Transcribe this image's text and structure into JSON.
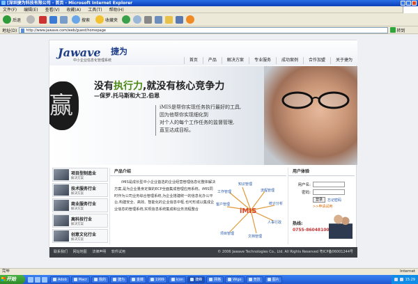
{
  "window": {
    "title": "[深圳捷为科技有限公司 - 首页 - Microsoft Internet Explorer"
  },
  "menu": [
    "文件(F)",
    "编辑(E)",
    "查看(V)",
    "收藏(A)",
    "工具(T)",
    "帮助(H)"
  ],
  "toolbar": {
    "back": "后退",
    "search": "搜索",
    "favorites": "收藏夹"
  },
  "address": {
    "label": "地址(D)",
    "url": "http://www.jawave.com/web/guest/homepage",
    "go": "转到"
  },
  "site": {
    "logo_en": "Jawave",
    "logo_cn": "捷为",
    "logo_sub": "中小企业信息化管理系统",
    "nav": [
      "首页",
      "产品",
      "解决方案",
      "专业服务",
      "成功案例",
      "合作加盟",
      "关于捷为"
    ],
    "banner": {
      "seal": "赢",
      "headline_a": "没有",
      "headline_hl": "执行力",
      "headline_b": ",就没有核心竞争力",
      "author": "—保罗.托马斯和大卫.伯恩",
      "quote": [
        "iMIS是帮你实现任务执行最好的工具,",
        "因为他帮你实现细化到",
        "对个人的每个工作任务的监督管理,",
        "直至达成目标。"
      ]
    },
    "sidebar": [
      {
        "title": "项目型制造业",
        "sub": "解决方案"
      },
      {
        "title": "技术服务行业",
        "sub": "解决方案"
      },
      {
        "title": "商业服务行业",
        "sub": "解决方案"
      },
      {
        "title": "高科技行业",
        "sub": "解决方案"
      },
      {
        "title": "创意文化行业",
        "sub": "解决方案"
      }
    ],
    "product": {
      "title": "产品介绍",
      "intro": "iMIS是成长型中小企业首选的企业经营管理信息化整体解决方案,是为企业量身定做的ECP全面集成管理应用系统。iMIS同时作为公司业务综合管理系统,为企业搭建统一的信息化办公平台,构建安全、高效、智能化的企业信息中枢,也可形成以集成企业信息的管理系统,实现信息系统集成和业务流程整合",
      "diagram": {
        "center": "iMIS",
        "nodes": [
          "知识管理",
          "流程管理",
          "统计分析",
          "人事行政",
          "文档管理",
          "项目管理",
          "客户管理",
          "工作管理"
        ]
      }
    },
    "login": {
      "title": "用户体验",
      "username_label": "用户名:",
      "password_label": "密码:",
      "login_btn": "登录",
      "forgot": "忘记密码",
      "join": ">>申请试用",
      "hotline_label": "热线:",
      "hotline": "0755-86048100"
    },
    "footer": {
      "links": [
        "联系我们",
        "网站地图",
        "法律声明",
        "软件试用"
      ],
      "copyright": "© 2006 Jawave Technologies Co., Ltd. All Rights Reserved 粤ICP备06001244号"
    }
  },
  "status": {
    "text": "完毕",
    "zone": "Internet"
  },
  "taskbar": {
    "start": "开始",
    "tasks": [
      "Adob",
      "Macr",
      "我的",
      "捷为",
      "金蝶",
      "1999",
      "icon",
      "捷峰",
      "网格",
      "Wigo",
      "竞技",
      "图片"
    ],
    "active_index": 7,
    "tray_time": "15:29"
  }
}
